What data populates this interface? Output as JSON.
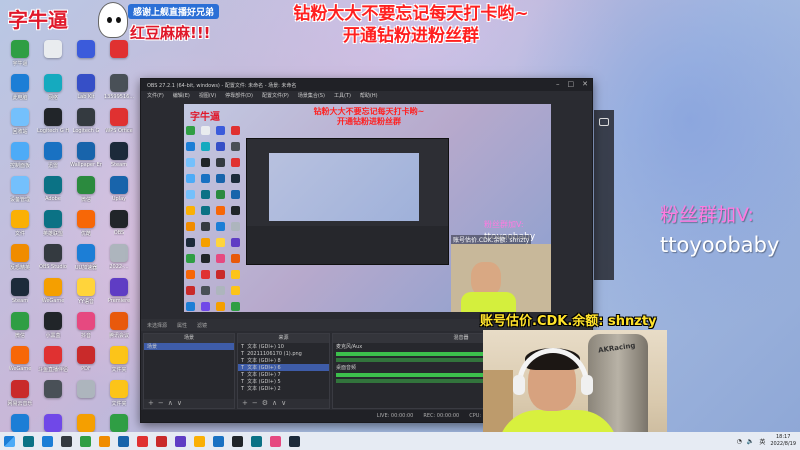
{
  "overlay": {
    "logo": "字牛逼",
    "top_banner": "感谢上舰直播好兄弟",
    "red_banner": "红豆麻麻!!!",
    "headline_line1": "钻粉大大不要忘记每天打卡哟~",
    "headline_line2": "开通钻粉进粉丝群",
    "fan_group_label": "粉丝群加V:",
    "fan_group_id": "ttoyoobaby",
    "cam_banner": "账号估价.CDK.余额: shnzty",
    "chair_brand": "AKRacing"
  },
  "desktop_icons": [
    {
      "label": "宇牛逼",
      "color": "#2f9e44"
    },
    {
      "label": "",
      "color": "#e9ecef"
    },
    {
      "label": "",
      "color": "#3b5bdb"
    },
    {
      "label": "",
      "color": "#e03131"
    },
    {
      "label": "此电脑",
      "color": "#1c7ed6"
    },
    {
      "label": "网络",
      "color": "#15aabf"
    },
    {
      "label": "Lab Kit",
      "color": "#364fc7"
    },
    {
      "label": "13599516...",
      "color": "#495057"
    },
    {
      "label": "回收站",
      "color": "#74c0fc"
    },
    {
      "label": "Logitech G HUB",
      "color": "#212529"
    },
    {
      "label": "Logitech G",
      "color": "#343a40"
    },
    {
      "label": "WPS Office",
      "color": "#e03131"
    },
    {
      "label": "控制面板",
      "color": "#4dabf7"
    },
    {
      "label": "迅雷",
      "color": "#1971c2"
    },
    {
      "label": "Wallpaper Engine",
      "color": "#1864ab"
    },
    {
      "label": "Steam",
      "color": "#1c2a3a"
    },
    {
      "label": "设备管理",
      "color": "#74c0fc"
    },
    {
      "label": "Adobe",
      "color": "#0b7285"
    },
    {
      "label": "微信",
      "color": "#2b8a3e"
    },
    {
      "label": "Uplay",
      "color": "#1864ab"
    },
    {
      "label": "文件",
      "color": "#fab005"
    },
    {
      "label": "英雄联盟",
      "color": "#0b7285"
    },
    {
      "label": "优酷",
      "color": "#f76707"
    },
    {
      "label": "OBS",
      "color": "#212529"
    },
    {
      "label": "反恐精英",
      "color": "#f08c00"
    },
    {
      "label": "OBS Studio",
      "color": "#343a40"
    },
    {
      "label": "UU加速器",
      "color": "#1c7ed6"
    },
    {
      "label": "2022-...",
      "color": "#adb5bd"
    },
    {
      "label": "Steam",
      "color": "#1c2a3a"
    },
    {
      "label": "WeGame",
      "color": "#f59f00"
    },
    {
      "label": "YY语音",
      "color": "#ffd43b"
    },
    {
      "label": "Premiere",
      "color": "#5f3dc4"
    },
    {
      "label": "微信",
      "color": "#2f9e44"
    },
    {
      "label": "小黑盒",
      "color": "#212529"
    },
    {
      "label": "抖音",
      "color": "#e64980"
    },
    {
      "label": "腾讯会议",
      "color": "#e8590c"
    },
    {
      "label": "WeGame",
      "color": "#f76707"
    },
    {
      "label": "斗鱼直播伴侣",
      "color": "#e03131"
    },
    {
      "label": "PDF",
      "color": "#c92a2a"
    },
    {
      "label": "文件夹",
      "color": "#fcc419"
    },
    {
      "label": "网易云音乐",
      "color": "#c92a2a"
    },
    {
      "label": "",
      "color": "#495057"
    },
    {
      "label": "",
      "color": "#adb5bd"
    },
    {
      "label": "文件夹",
      "color": "#fcc419"
    },
    {
      "label": "QQ",
      "color": "#1c7ed6"
    },
    {
      "label": "Sogou",
      "color": "#7048e8"
    },
    {
      "label": "QQ游戏",
      "color": "#f59f00"
    },
    {
      "label": "iQIYI",
      "color": "#2f9e44"
    }
  ],
  "obs": {
    "title": "OBS 27.2.1 (64-bit, windows) - 配置文件: 未命名 - 场景: 未命名",
    "menu": [
      "文件(F)",
      "编辑(E)",
      "视图(V)",
      "停靠部件(D)",
      "配置文件(P)",
      "场景集合(S)",
      "工具(T)",
      "帮助(H)"
    ],
    "source_bar_label": "未选择源",
    "props_label": "属性",
    "filters_label": "滤镜",
    "docks": {
      "scenes": {
        "title": "场景",
        "items": [
          "场景"
        ]
      },
      "sources": {
        "title": "来源",
        "items": [
          "文本 (GDI+) 10",
          "20211106170 (1).png",
          "文本 (GDI+) 8",
          "文本 (GDI+) 6",
          "文本 (GDI+) 7",
          "文本 (GDI+) 5",
          "文本 (GDI+) 2"
        ],
        "selected_index": 3
      },
      "mixer": {
        "title": "混音器",
        "tracks": [
          {
            "name": "麦克风/Aux",
            "level": 0.7
          },
          {
            "name": "桌面音频",
            "level": 0.55
          }
        ]
      }
    },
    "status": [
      "LIVE: 00:00:00",
      "REC: 00:00:00",
      "CPU: 2.1%, 60.00 fps"
    ]
  },
  "taskbar": {
    "icons": [
      "#0b7285",
      "#1c7ed6",
      "#343a40",
      "#2f9e44",
      "#f08c00",
      "#1864ab",
      "#e03131",
      "#c92a2a",
      "#5f3dc4",
      "#fab005",
      "#1971c2",
      "#212529",
      "#0b7285",
      "#e64980",
      "#1c2a3a"
    ],
    "time": "18:17",
    "date": "2022/8/19",
    "lang": "英"
  }
}
